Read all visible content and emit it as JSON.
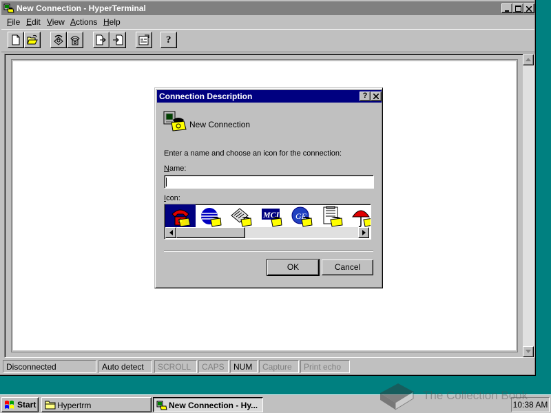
{
  "window": {
    "title": "New Connection - HyperTerminal",
    "menu": [
      {
        "key": "F",
        "rest": "ile"
      },
      {
        "key": "E",
        "rest": "dit"
      },
      {
        "key": "V",
        "rest": "iew"
      },
      {
        "key": "A",
        "rest": "ctions"
      },
      {
        "key": "H",
        "rest": "elp"
      }
    ],
    "toolbar": {
      "icons": [
        "new-document-icon",
        "open-folder-icon",
        "connect-phone-icon",
        "disconnect-phone-icon",
        "send-file-icon",
        "receive-file-icon",
        "properties-icon",
        "help-icon"
      ],
      "help_glyph": "?"
    },
    "status": {
      "connection": "Disconnected",
      "detect": "Auto detect",
      "scroll": "SCROLL",
      "caps": "CAPS",
      "num": "NUM",
      "capture": "Capture",
      "print_echo": "Print echo"
    }
  },
  "dialog": {
    "title": "Connection Description",
    "help_glyph": "?",
    "header": "New Connection",
    "instruction": "Enter a name and choose an icon for the connection:",
    "name_label_key": "N",
    "name_label_rest": "ame:",
    "name_value": "",
    "icon_label_key": "I",
    "icon_label_rest": "con:",
    "icons": [
      "red-phone-icon",
      "globe-phone-icon",
      "phone-rack-icon",
      "mci-phone-icon",
      "ge-phone-icon",
      "notepad-phone-icon",
      "umbrella-phone-icon"
    ],
    "mci_text": "MCI",
    "ge_text": "GE",
    "ok_label": "OK",
    "cancel_label": "Cancel"
  },
  "taskbar": {
    "start_label": "Start",
    "tasks": [
      {
        "label": "Hypertrm",
        "pressed": false
      },
      {
        "label": "New Connection - Hy...",
        "pressed": true
      }
    ],
    "clock": "10:38 AM"
  },
  "watermark": "The Collection Book",
  "colors": {
    "desktop": "#008080",
    "face": "#c0c0c0",
    "active_title": "#000080",
    "inactive_title": "#808080"
  }
}
